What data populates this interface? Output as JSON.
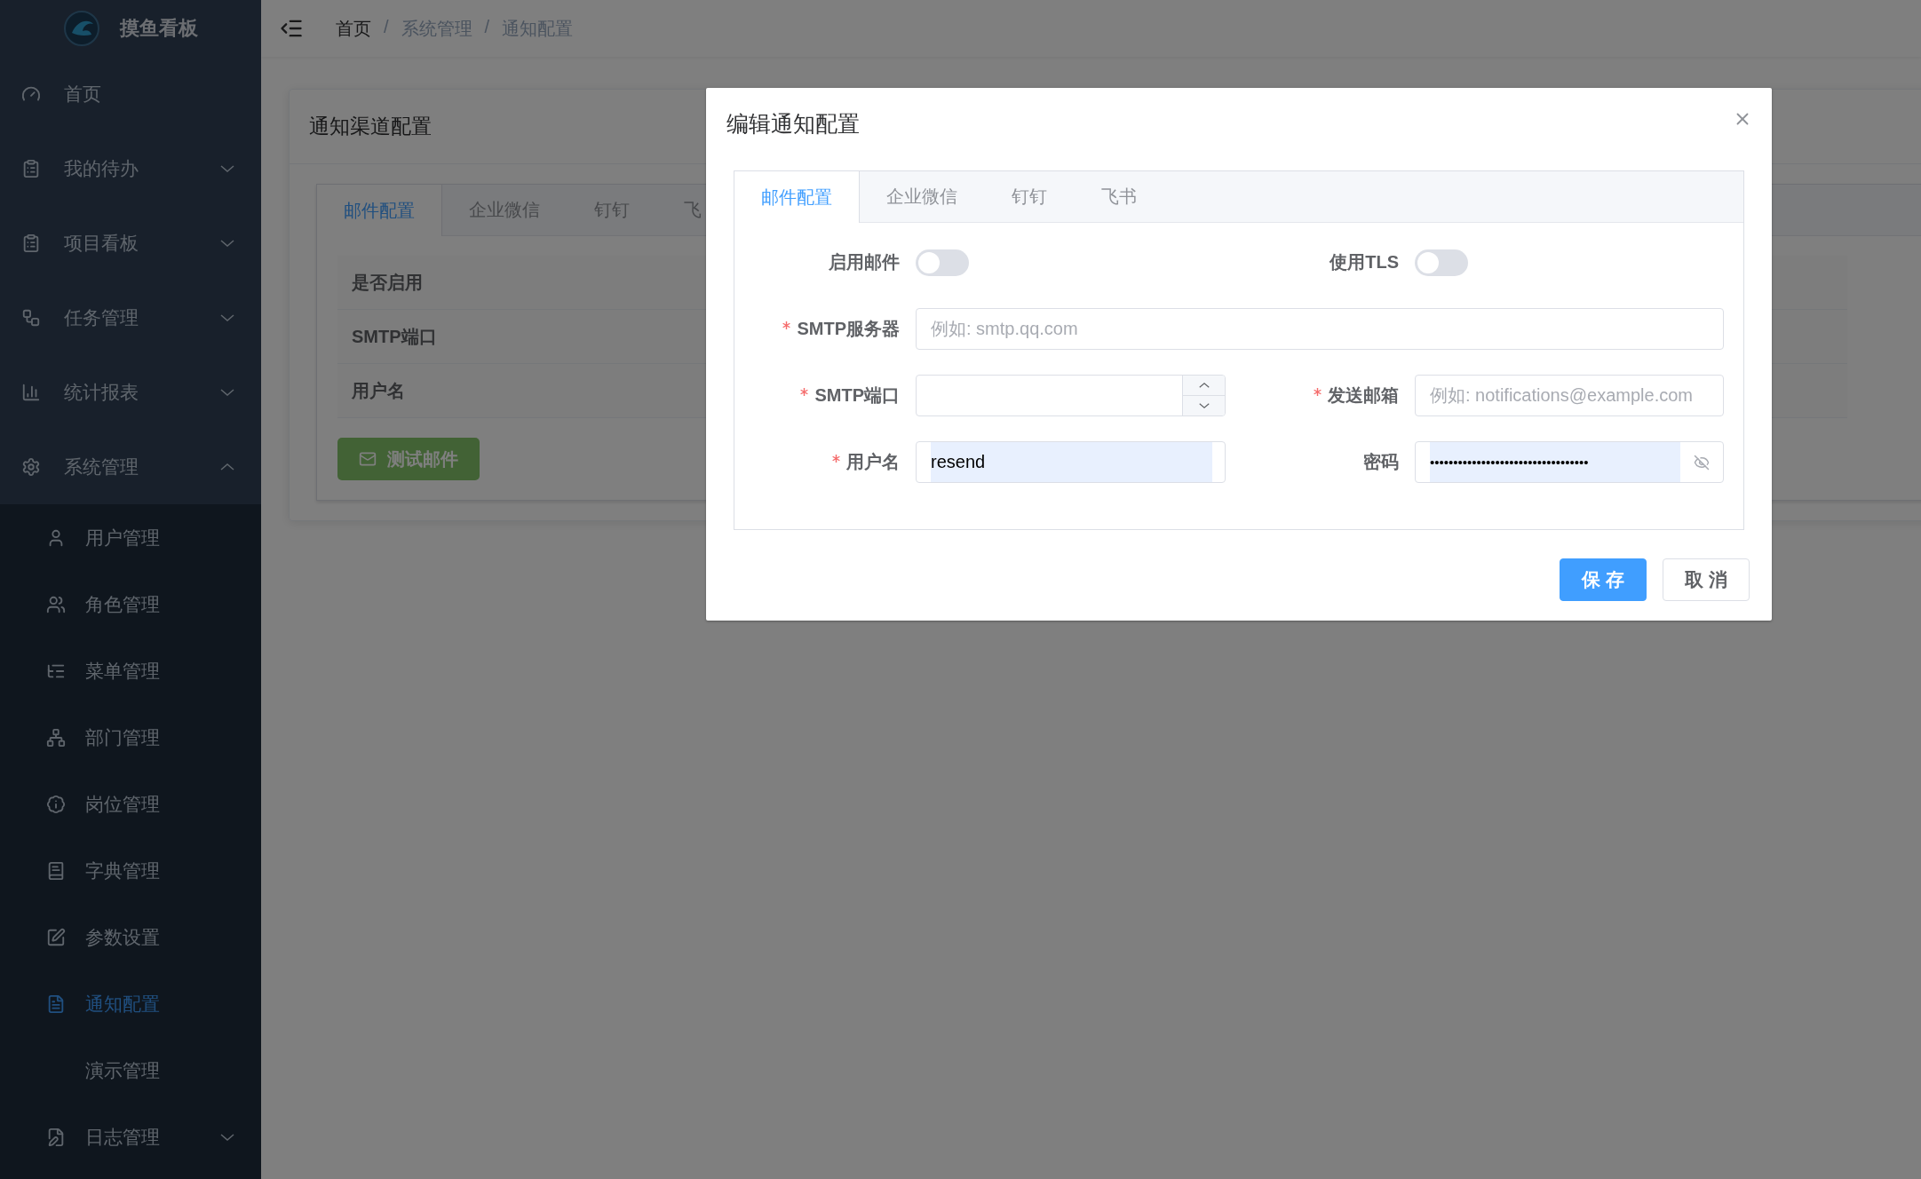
{
  "sidebar": {
    "logo_text": "摸鱼看板",
    "items": [
      {
        "label": "首页",
        "selected": false
      },
      {
        "label": "我的待办",
        "selected": false,
        "expanded": false
      },
      {
        "label": "项目看板",
        "selected": false,
        "expanded": false
      },
      {
        "label": "任务管理",
        "selected": false,
        "expanded": false
      },
      {
        "label": "统计报表",
        "selected": false,
        "expanded": false
      },
      {
        "label": "系统管理",
        "selected": false,
        "expanded": true,
        "children": [
          {
            "label": "用户管理",
            "selected": false
          },
          {
            "label": "角色管理",
            "selected": false
          },
          {
            "label": "菜单管理",
            "selected": false
          },
          {
            "label": "部门管理",
            "selected": false
          },
          {
            "label": "岗位管理",
            "selected": false
          },
          {
            "label": "字典管理",
            "selected": false
          },
          {
            "label": "参数设置",
            "selected": false
          },
          {
            "label": "通知配置",
            "selected": true
          },
          {
            "label": "演示管理",
            "selected": false
          },
          {
            "label": "日志管理",
            "selected": false,
            "expanded": false
          }
        ]
      }
    ]
  },
  "breadcrumb": [
    "首页",
    "/",
    "系统管理",
    "/",
    "通知配置"
  ],
  "card": {
    "title": "通知渠道配置",
    "tabs": [
      {
        "label": "邮件配置",
        "selected": true
      },
      {
        "label": "企业微信",
        "selected": false
      },
      {
        "label": "钉钉",
        "selected": false
      },
      {
        "label": "飞",
        "selected": false
      }
    ],
    "rows": [
      "是否启用",
      "SMTP端口",
      "用户名"
    ],
    "test_button": "测试邮件"
  },
  "dialog": {
    "title": "编辑通知配置",
    "tabs": [
      {
        "label": "邮件配置",
        "selected": true
      },
      {
        "label": "企业微信",
        "selected": false
      },
      {
        "label": "钉钉",
        "selected": false
      },
      {
        "label": "飞书",
        "selected": false
      }
    ],
    "toggles": [
      {
        "label": "启用邮件",
        "on": false
      },
      {
        "label": "使用TLS",
        "on": false
      }
    ],
    "smtp_server": {
      "label": "SMTP服务器",
      "required": true,
      "placeholder": "例如: smtp.qq.com"
    },
    "smtp_port": {
      "label": "SMTP端口",
      "required": true
    },
    "sender": {
      "label": "发送邮箱",
      "required": true,
      "placeholder": "例如: notifications@example.com"
    },
    "username": {
      "label": "用户名",
      "required": true,
      "value": "resend"
    },
    "password": {
      "label": "密码",
      "required": false,
      "value": "••••••••••••••••••••••••••••••••••"
    },
    "buttons": [
      {
        "label": "保 存",
        "kind": "primary"
      },
      {
        "label": "取 消",
        "kind": "default"
      }
    ]
  }
}
